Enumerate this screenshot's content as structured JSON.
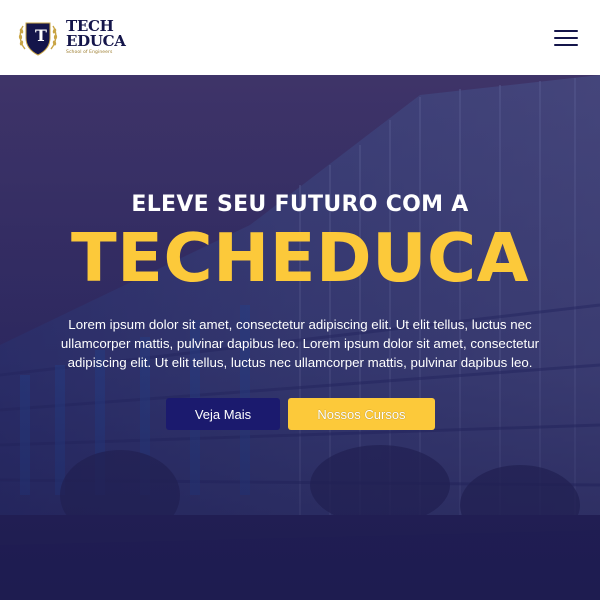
{
  "brand": {
    "emblem_letter": "T",
    "line1": "TECH",
    "line2": "EDUCA",
    "tagline": "School of Engineers",
    "colors": {
      "navy": "#14154a",
      "gold": "#c9a545"
    }
  },
  "menu": {
    "icon": "hamburger-menu-icon"
  },
  "hero": {
    "kicker": "ELEVE SEU FUTURO COM A",
    "title": "TECHEDUCA",
    "description": "Lorem ipsum dolor sit amet, consectetur adipiscing elit. Ut elit tellus, luctus nec ullamcorper mattis, pulvinar dapibus leo. Lorem ipsum dolor sit amet, consectetur adipiscing elit. Ut elit tellus, luctus nec ullamcorper mattis, pulvinar dapibus leo.",
    "primary_button": "Veja Mais",
    "secondary_button": "Nossos Cursos",
    "colors": {
      "title": "#fcc93a",
      "overlay": "#2a2660",
      "primary_button": "#1b1a6e",
      "secondary_button": "#fcc93a"
    }
  }
}
